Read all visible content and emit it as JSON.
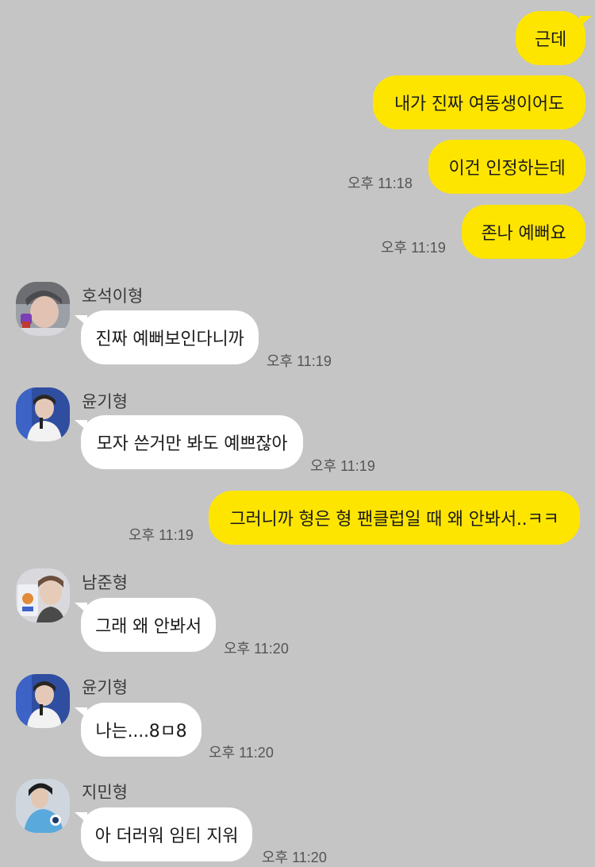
{
  "messages": [
    {
      "text": "근데"
    },
    {
      "text": "내가 진짜 여동생이어도"
    },
    {
      "text": "이건 인정하는데",
      "time": "오후 11:18"
    },
    {
      "text": "존나 예뻐요",
      "time": "오후 11:19"
    },
    {
      "sender": "호석이형",
      "text": "진짜 예뻐보인다니까",
      "time": "오후 11:19"
    },
    {
      "sender": "윤기형",
      "text": "모자 쓴거만 봐도 예쁘잖아",
      "time": "오후 11:19"
    },
    {
      "text": "그러니까 형은 형 팬클럽일 때 왜 안봐서..ㅋㅋ",
      "time": "오후 11:19"
    },
    {
      "sender": "남준형",
      "text": "그래 왜 안봐서",
      "time": "오후 11:20"
    },
    {
      "sender": "윤기형",
      "text": "나는....8ㅁ8",
      "time": "오후 11:20"
    },
    {
      "sender": "지민형",
      "text": "아 더러워 임티 지워",
      "time": "오후 11:20"
    }
  ],
  "colors": {
    "background": "#c5c5c5",
    "my_bubble": "#fee500",
    "their_bubble": "#ffffff"
  }
}
